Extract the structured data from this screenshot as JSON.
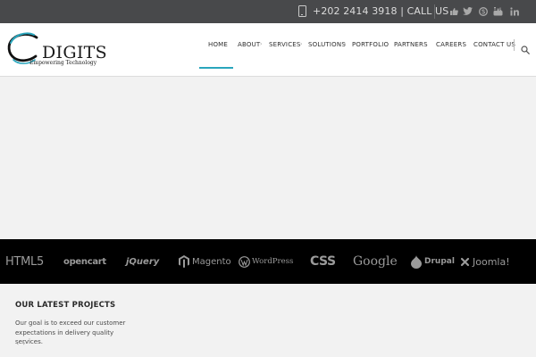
{
  "topbar": {
    "call_text": "+202 2414 3918 | CALL US",
    "icons": [
      "phone-icon",
      "thumbs-up-icon",
      "twitter-icon",
      "skype-icon",
      "youtube-icon",
      "linkedin-icon"
    ]
  },
  "header": {
    "logo_text": "DIGITS",
    "logo_tagline": "Empowering Technology",
    "nav": [
      "HOME",
      "ABOUT",
      "SERVICES",
      "SOLUTIONS",
      "PORTFOLIO",
      "PARTNERS",
      "CAREERS",
      "CONTACT US"
    ],
    "active_nav": "HOME",
    "accent_color": "#2aa6bd"
  },
  "tech_logos": [
    "HTML5",
    "opencart",
    "jQuery",
    "Magento",
    "WordPress",
    "CSS",
    "Google",
    "Drupal",
    "Joomla!"
  ],
  "projects": {
    "title": "OUR LATEST PROJECTS",
    "description": "Our goal is to exceed our customer expectations in delivery quality services.",
    "prev": "‹",
    "next": "›"
  }
}
